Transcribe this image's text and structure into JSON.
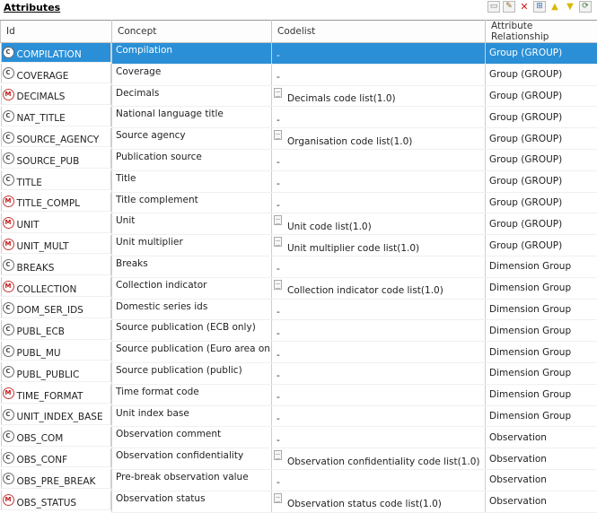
{
  "section_title": "Attributes",
  "toolbar": [
    "new-icon",
    "edit-icon",
    "delete-icon",
    "tree-icon",
    "up-icon",
    "down-icon",
    "refresh-icon"
  ],
  "columns": {
    "id": "Id",
    "concept": "Concept",
    "codelist": "Codelist",
    "relationship": "Attribute Relationship"
  },
  "rows": [
    {
      "type": "C",
      "id": "COMPILATION",
      "concept": "Compilation",
      "codelist": "-",
      "has_codelist": false,
      "relationship": "Group (GROUP)",
      "selected": true
    },
    {
      "type": "C",
      "id": "COVERAGE",
      "concept": "Coverage",
      "codelist": "-",
      "has_codelist": false,
      "relationship": "Group (GROUP)"
    },
    {
      "type": "M",
      "id": "DECIMALS",
      "concept": "Decimals",
      "codelist": "Decimals code list(1.0)",
      "has_codelist": true,
      "relationship": "Group (GROUP)"
    },
    {
      "type": "C",
      "id": "NAT_TITLE",
      "concept": "National language title",
      "codelist": "-",
      "has_codelist": false,
      "relationship": "Group (GROUP)"
    },
    {
      "type": "C",
      "id": "SOURCE_AGENCY",
      "concept": "Source agency",
      "codelist": "Organisation code list(1.0)",
      "has_codelist": true,
      "relationship": "Group (GROUP)"
    },
    {
      "type": "C",
      "id": "SOURCE_PUB",
      "concept": "Publication source",
      "codelist": "-",
      "has_codelist": false,
      "relationship": "Group (GROUP)"
    },
    {
      "type": "C",
      "id": "TITLE",
      "concept": "Title",
      "codelist": "-",
      "has_codelist": false,
      "relationship": "Group (GROUP)"
    },
    {
      "type": "M",
      "id": "TITLE_COMPL",
      "concept": "Title complement",
      "codelist": "-",
      "has_codelist": false,
      "relationship": "Group (GROUP)"
    },
    {
      "type": "M",
      "id": "UNIT",
      "concept": "Unit",
      "codelist": "Unit code list(1.0)",
      "has_codelist": true,
      "relationship": "Group (GROUP)"
    },
    {
      "type": "M",
      "id": "UNIT_MULT",
      "concept": "Unit multiplier",
      "codelist": "Unit multiplier code list(1.0)",
      "has_codelist": true,
      "relationship": "Group (GROUP)"
    },
    {
      "type": "C",
      "id": "BREAKS",
      "concept": "Breaks",
      "codelist": "-",
      "has_codelist": false,
      "relationship": "Dimension Group"
    },
    {
      "type": "M",
      "id": "COLLECTION",
      "concept": "Collection indicator",
      "codelist": "Collection indicator code list(1.0)",
      "has_codelist": true,
      "relationship": "Dimension Group"
    },
    {
      "type": "C",
      "id": "DOM_SER_IDS",
      "concept": "Domestic series ids",
      "codelist": "-",
      "has_codelist": false,
      "relationship": "Dimension Group"
    },
    {
      "type": "C",
      "id": "PUBL_ECB",
      "concept": "Source publication (ECB only)",
      "codelist": "-",
      "has_codelist": false,
      "relationship": "Dimension Group"
    },
    {
      "type": "C",
      "id": "PUBL_MU",
      "concept": "Source publication (Euro area only",
      "codelist": "-",
      "has_codelist": false,
      "relationship": "Dimension Group"
    },
    {
      "type": "C",
      "id": "PUBL_PUBLIC",
      "concept": "Source publication (public)",
      "codelist": "-",
      "has_codelist": false,
      "relationship": "Dimension Group"
    },
    {
      "type": "M",
      "id": "TIME_FORMAT",
      "concept": "Time format code",
      "codelist": "-",
      "has_codelist": false,
      "relationship": "Dimension Group"
    },
    {
      "type": "C",
      "id": "UNIT_INDEX_BASE",
      "concept": "Unit index base",
      "codelist": "-",
      "has_codelist": false,
      "relationship": "Dimension Group"
    },
    {
      "type": "C",
      "id": "OBS_COM",
      "concept": "Observation comment",
      "codelist": "-",
      "has_codelist": false,
      "relationship": "Observation"
    },
    {
      "type": "C",
      "id": "OBS_CONF",
      "concept": "Observation confidentiality",
      "codelist": "Observation confidentiality code list(1.0)",
      "has_codelist": true,
      "relationship": "Observation"
    },
    {
      "type": "C",
      "id": "OBS_PRE_BREAK",
      "concept": "Pre-break observation value",
      "codelist": "-",
      "has_codelist": false,
      "relationship": "Observation"
    },
    {
      "type": "M",
      "id": "OBS_STATUS",
      "concept": "Observation status",
      "codelist": "Observation status code list(1.0)",
      "has_codelist": true,
      "relationship": "Observation"
    }
  ]
}
